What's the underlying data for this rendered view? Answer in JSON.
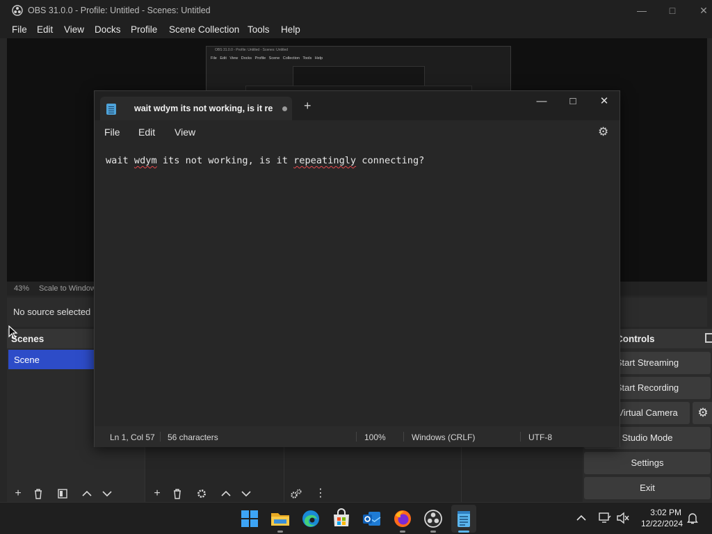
{
  "obs": {
    "title": "OBS 31.0.0 - Profile: Untitled - Scenes: Untitled",
    "menu": [
      "File",
      "Edit",
      "View",
      "Docks",
      "Profile",
      "Scene Collection",
      "Tools",
      "Help"
    ],
    "preview_mini": {
      "title": "OBS 31.0.0 - Profile: Untitled - Scenes: Untitled",
      "menu": "File Edit View Docks Profile Scene Collection Tools Help"
    },
    "zoom": "43%",
    "scale_mode": "Scale to Window",
    "no_source": "No source selected",
    "scenes": {
      "title": "Scenes",
      "items": [
        "Scene"
      ]
    },
    "controls": {
      "title": "Controls",
      "start_streaming": "Start Streaming",
      "start_recording": "Start Recording",
      "virtual_camera": "Start Virtual Camera",
      "studio_mode": "Studio Mode",
      "settings": "Settings",
      "exit": "Exit"
    }
  },
  "notepad": {
    "tab_title": "wait wdym its not working, is it re",
    "menu": {
      "file": "File",
      "edit": "Edit",
      "view": "View"
    },
    "content": {
      "before1": "wait ",
      "misspelled1": "wdym",
      "between": " its not working, is it ",
      "misspelled2": "repeatingly",
      "after": " connecting?"
    },
    "status": {
      "position": "Ln 1, Col 57",
      "chars": "56 characters",
      "zoom": "100%",
      "line_ending": "Windows (CRLF)",
      "encoding": "UTF-8"
    }
  },
  "taskbar": {
    "apps": [
      "start-icon",
      "file-explorer-icon",
      "edge-icon",
      "store-icon",
      "outlook-icon",
      "firefox-icon",
      "obs-icon",
      "notepad-icon"
    ],
    "time": "3:02 PM",
    "date": "12/22/2024"
  },
  "colors": {
    "scene_selected": "#2d4cc8",
    "spellcheck": "#e8474c",
    "notepad_icon": "#4ea3d9"
  }
}
